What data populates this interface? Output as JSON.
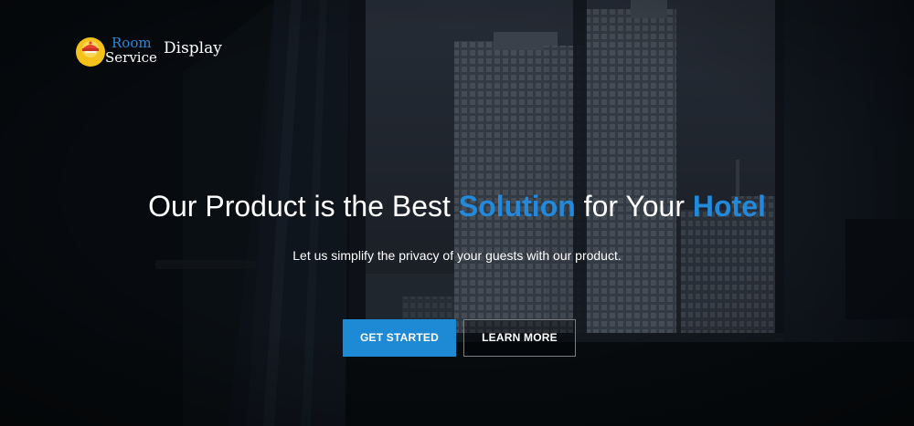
{
  "brand": {
    "name_line1": "Room",
    "name_line2": "Service",
    "name_suffix": "Display",
    "icon": "room-service-bell-icon",
    "colors": {
      "badge": "#f5c21b",
      "badge_inner": "#e8402d",
      "accent": "#2389db"
    }
  },
  "hero": {
    "headline_part1": "Our Product is the Best ",
    "headline_accent1": "Solution",
    "headline_part2": " for Your ",
    "headline_accent2": "Hotel",
    "subtitle": "Let us simplify the privacy of your guests with our product."
  },
  "buttons": {
    "get_started": "GET STARTED",
    "learn_more": "LEARN MORE"
  },
  "colors": {
    "primary_button": "#1e8ad6",
    "background": "#0d1116"
  }
}
